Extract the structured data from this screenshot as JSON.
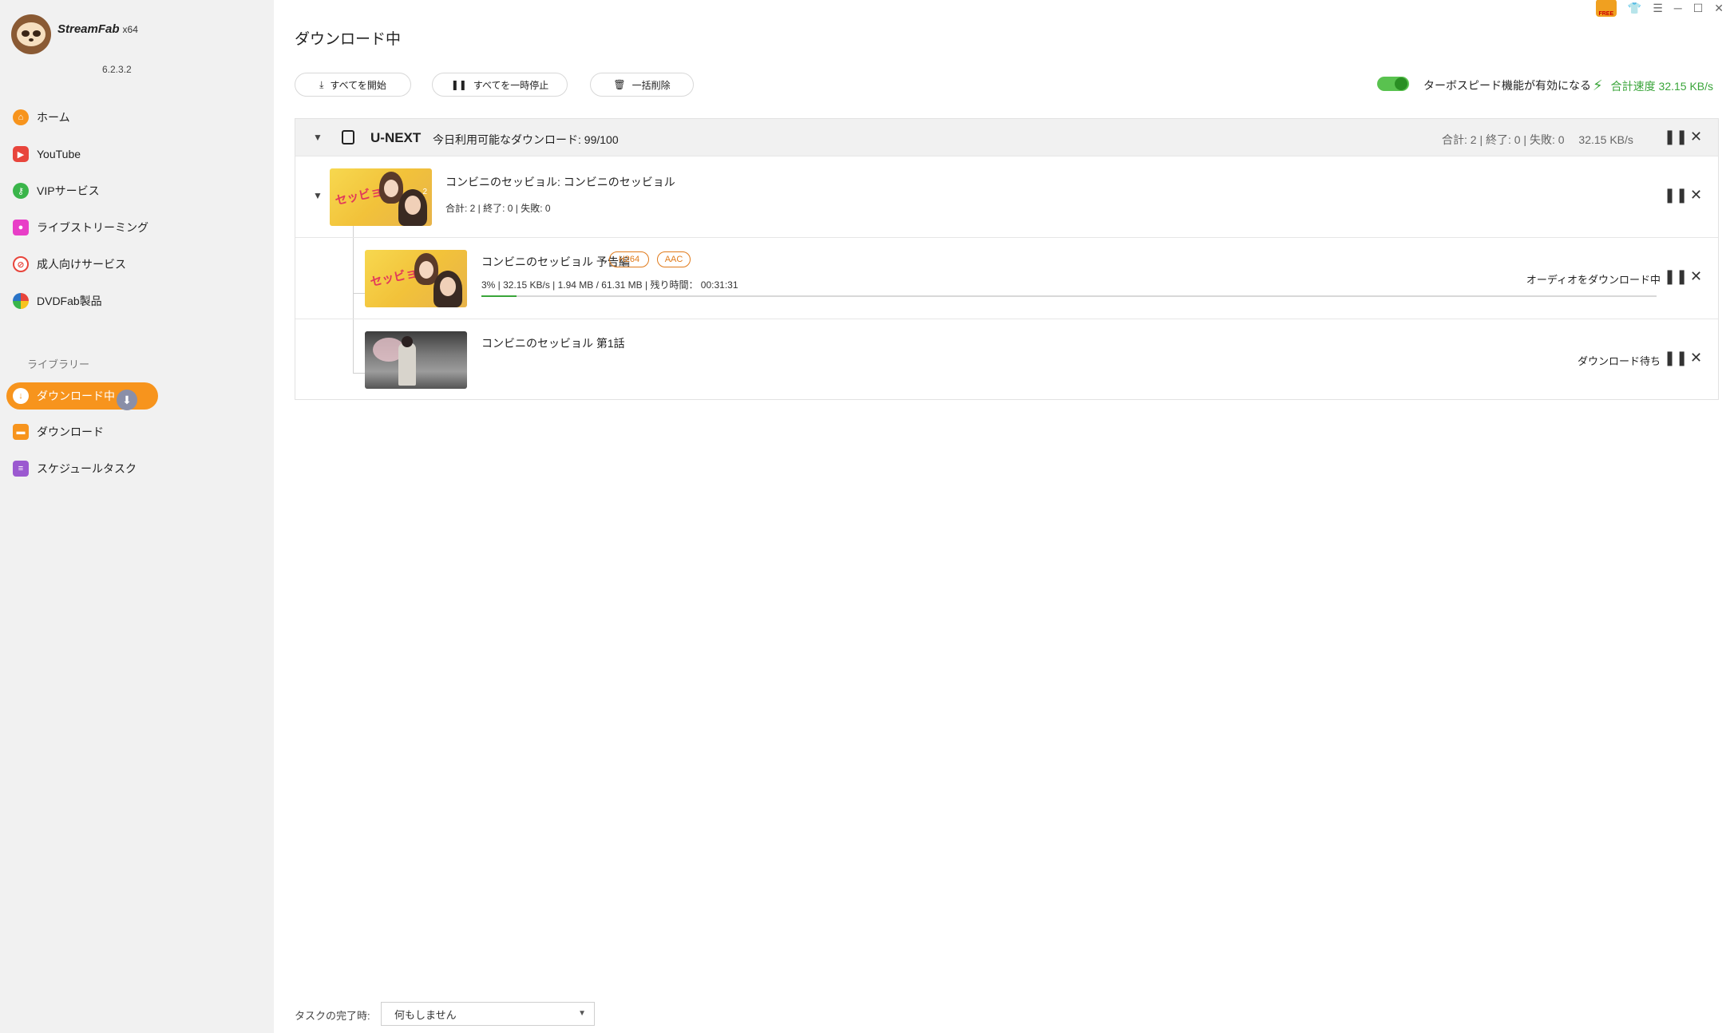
{
  "app": {
    "brand": "StreamFab",
    "arch": "x64",
    "version": "6.2.3.2"
  },
  "sidebar": {
    "items": [
      {
        "label": "ホーム",
        "icon": "home-icon",
        "color": "#f7941d"
      },
      {
        "label": "YouTube",
        "icon": "youtube-icon",
        "color": "#e8453c"
      },
      {
        "label": "VIPサービス",
        "icon": "key-icon",
        "color": "#3ab54a"
      },
      {
        "label": "ライブストリーミング",
        "icon": "camera-icon",
        "color": "#e83ec7"
      },
      {
        "label": "成人向けサービス",
        "icon": "adult-icon",
        "color": "#e8453c"
      },
      {
        "label": "DVDFab製品",
        "icon": "dvdfab-icon",
        "color": "#2a74c7"
      }
    ],
    "library_label": "ライブラリー",
    "library": [
      {
        "label": "ダウンロード中",
        "icon": "download-icon",
        "active": true
      },
      {
        "label": "ダウンロード",
        "icon": "folder-icon",
        "color": "#f7941d"
      },
      {
        "label": "スケジュールタスク",
        "icon": "schedule-icon",
        "color": "#9b59d0"
      }
    ]
  },
  "header": {
    "title": "ダウンロード中",
    "start_all": "すべてを開始",
    "pause_all": "すべてを一時停止",
    "delete_all": "一括削除",
    "turbo_label": "ターボスピード機能が有効になる",
    "turbo_on": true,
    "total_speed": "合計速度 32.15 KB/s"
  },
  "group": {
    "site": "U-NEXT",
    "quota": "今日利用可能なダウンロード: 99/100",
    "stats": "合計: 2 | 終了: 0 | 失敗: 0",
    "speed": "32.15 KB/s"
  },
  "series": {
    "title": "コンビニのセッビョル: コンビニのセッビョル",
    "stats": "合計: 2 | 終了: 0 | 失敗: 0",
    "episodes": "2"
  },
  "items": [
    {
      "title": "コンビニのセッビョル 予告編",
      "tags": [
        "H264",
        "AAC"
      ],
      "progress_line": "3% | 32.15 KB/s | 1.94 MB / 61.31 MB | 残り時間： 00:31:31",
      "progress": 0.03,
      "status": "オーディオをダウンロード中"
    },
    {
      "title": "コンビニのセッビョル 第1話",
      "status": "ダウンロード待ち"
    }
  ],
  "footer": {
    "label": "タスクの完了時:",
    "selected": "何もしません"
  },
  "accent": "#f7941d",
  "success": "#3aa53a"
}
